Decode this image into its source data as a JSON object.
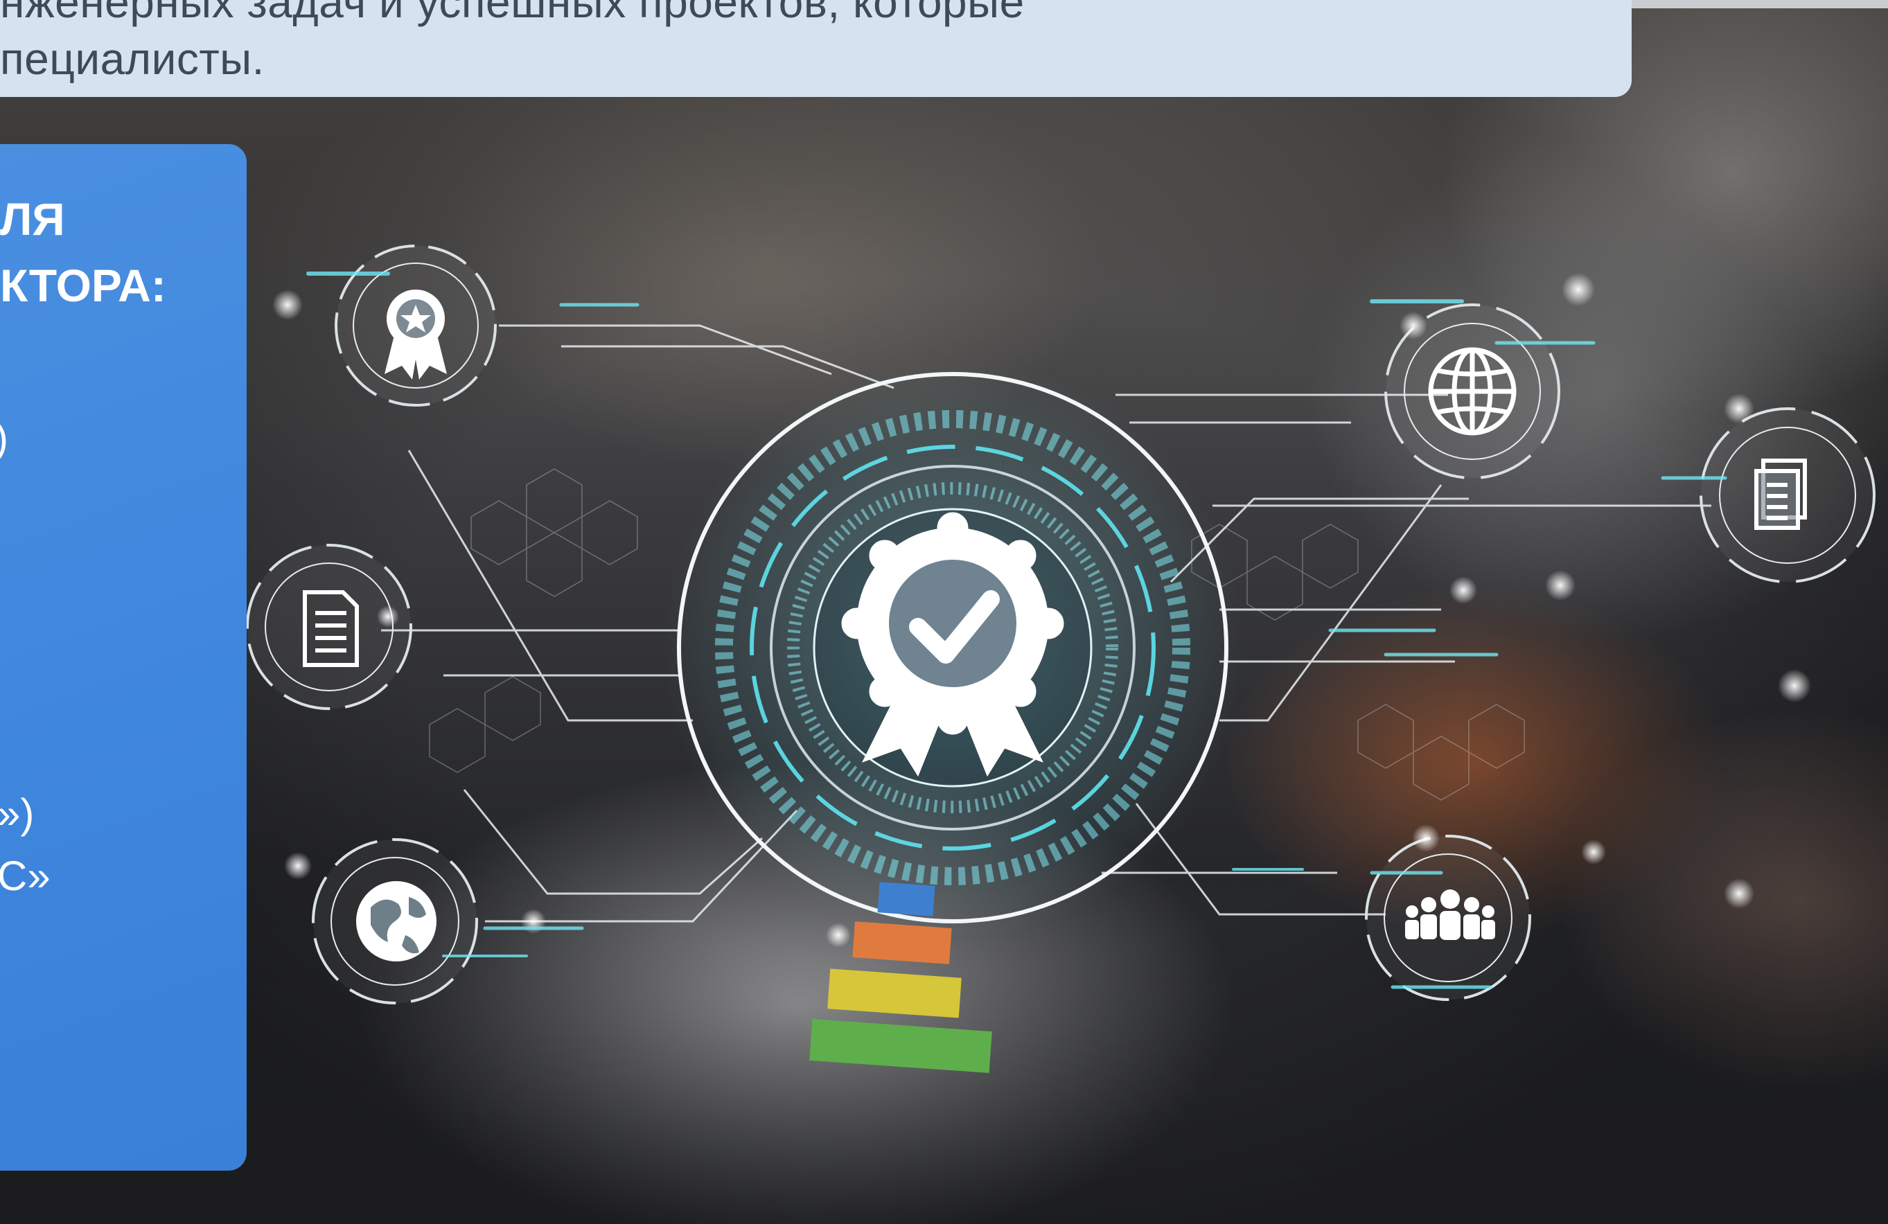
{
  "top_caption": {
    "line1": "нженерных задач и успешных проектов, которые",
    "line2": "пециалисты."
  },
  "left_panel": {
    "heading_line1": "ЛЯ",
    "heading_line2": "КТОРА:",
    "fragment_1": ")",
    "fragment_2": "»)",
    "fragment_3": "С»"
  },
  "icons": {
    "center": "certificate-check-icon",
    "top_left": "award-ribbon-icon",
    "mid_left": "document-icon",
    "bottom_left": "globe-earth-icon",
    "top_right": "globe-grid-icon",
    "mid_right": "documents-stack-icon",
    "bottom_right": "people-group-icon"
  },
  "colors": {
    "panel_blue": "#3f86dd",
    "caption_bg": "#d6e2f0",
    "caption_text": "#3f4a57",
    "tech_cyan": "#5fe3ee"
  }
}
